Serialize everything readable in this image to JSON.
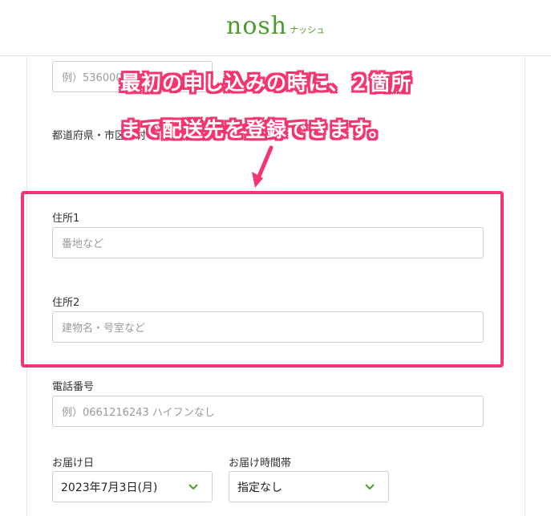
{
  "header": {
    "logo_main": "nosh",
    "logo_sub": "ナッシュ"
  },
  "form": {
    "postal": {
      "placeholder": "例）536000"
    },
    "prefecture": {
      "label": "都道府県・市区町村"
    },
    "address1": {
      "label": "住所1",
      "placeholder": "番地など"
    },
    "address2": {
      "label": "住所2",
      "placeholder": "建物名・号室など"
    },
    "phone": {
      "label": "電話番号",
      "placeholder": "例）0661216243 ハイフンなし"
    },
    "delivery_date": {
      "label": "お届け日",
      "value": "2023年7月3日(月)"
    },
    "delivery_time": {
      "label": "お届け時間帯",
      "value": "指定なし"
    }
  },
  "callout": {
    "line1": "最初の申し込みの時に、２箇所",
    "line2": "まで配送先を登録できます。"
  },
  "colors": {
    "accent": "#f4356f",
    "brand": "#4e9a2c"
  },
  "icons": {
    "dropdown": "chevron-down-icon",
    "pointer": "arrow-down-icon"
  }
}
